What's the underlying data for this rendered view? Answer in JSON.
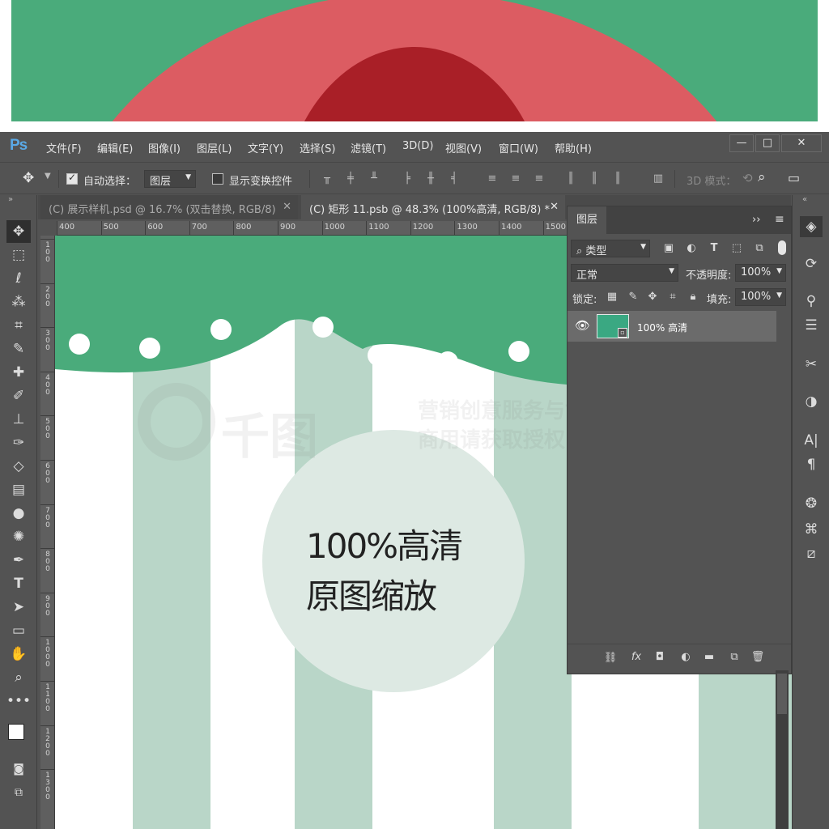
{
  "app": {
    "logo": "Ps",
    "menu": [
      "文件(F)",
      "编辑(E)",
      "图像(I)",
      "图层(L)",
      "文字(Y)",
      "选择(S)",
      "滤镜(T)",
      "3D(D)",
      "视图(V)",
      "窗口(W)",
      "帮助(H)"
    ],
    "window_controls": [
      "—",
      "□",
      "✕"
    ]
  },
  "options": {
    "auto_select_label": "自动选择：",
    "auto_select_value": "图层",
    "show_transform_label": "显示变换控件",
    "mode_3d_label": "3D 模式："
  },
  "tabs": [
    {
      "label": "(C) 展示样机.psd @ 16.7% (双击替换, RGB/8)",
      "close": "✕"
    },
    {
      "label": "(C) 矩形 11.psb @ 48.3% (100%高清, RGB/8) *",
      "close": "✕"
    }
  ],
  "ruler": {
    "top": [
      "400",
      "500",
      "600",
      "700",
      "800",
      "900",
      "1000",
      "1100",
      "1200",
      "1300",
      "1400",
      "1500"
    ],
    "left": [
      "100",
      "200",
      "300",
      "400",
      "500",
      "600",
      "700",
      "800",
      "900",
      "1000",
      "1100",
      "1200",
      "1300"
    ]
  },
  "canvas": {
    "line1": "100%高清",
    "line2": "原图缩放",
    "watermark_brand": "千图",
    "watermark_line1": "营销创意服务与协作平台",
    "watermark_line2": "商用请获取授权"
  },
  "layers_panel": {
    "title": "图层",
    "menu_glyph": "≡",
    "collapse_glyph": "››",
    "filter_label": "类型",
    "blend_mode": "正常",
    "opacity_label": "不透明度:",
    "opacity_value": "100%",
    "lock_label": "锁定:",
    "fill_label": "填充:",
    "fill_value": "100%",
    "layers": [
      {
        "name": "100% 高清",
        "visible": true
      }
    ],
    "footer_icons": [
      "link-icon",
      "fx-icon",
      "mask-icon",
      "adjustment-icon",
      "folder-icon",
      "new-layer-icon",
      "trash-icon"
    ]
  },
  "colors": {
    "green": "#4aab7b",
    "pink": "#dc5c62",
    "red": "#a91f27",
    "stripe": "#b9d6c8",
    "circle": "#dde9e3",
    "thumb": "#3aa882"
  }
}
